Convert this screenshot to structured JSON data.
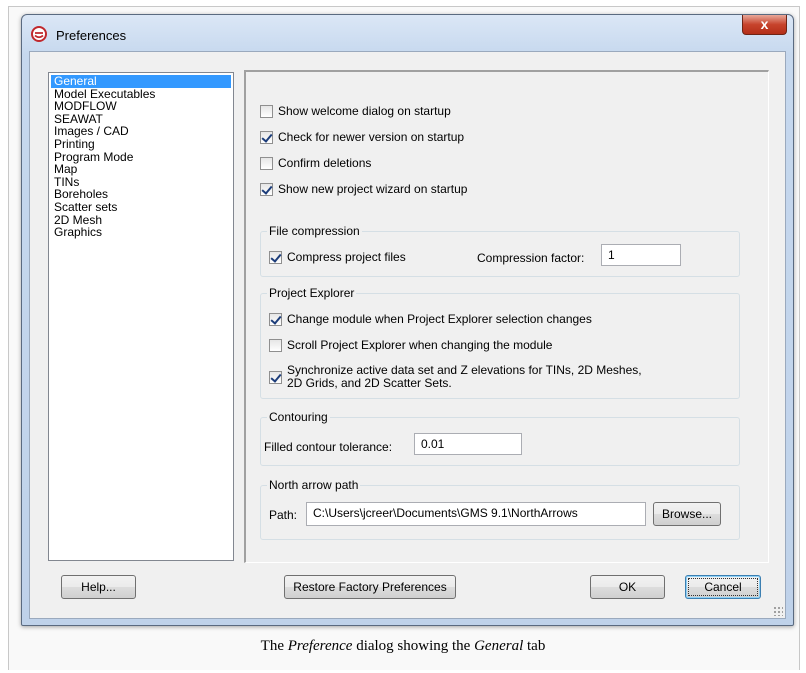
{
  "window": {
    "title": "Preferences",
    "close_label": "x",
    "icon": "app-logo-icon"
  },
  "categories": [
    "General",
    "Model Executables",
    "MODFLOW",
    "SEAWAT",
    "Images / CAD",
    "Printing",
    "Program Mode",
    "Map",
    "TINs",
    "Boreholes",
    "Scatter sets",
    "2D Mesh",
    "Graphics"
  ],
  "selected_category": "General",
  "general": {
    "show_welcome": {
      "label": "Show welcome dialog on startup",
      "checked": false
    },
    "check_newer": {
      "label": "Check for newer version on startup",
      "checked": true
    },
    "confirm_deletions": {
      "label": "Confirm deletions",
      "checked": false
    },
    "show_wizard": {
      "label": "Show new project wizard on startup",
      "checked": true
    }
  },
  "file_compression": {
    "title": "File compression",
    "compress_label": "Compress project files",
    "compress_checked": true,
    "factor_label": "Compression factor:",
    "factor_value": "1"
  },
  "project_explorer": {
    "title": "Project Explorer",
    "change_module": {
      "label": "Change module when Project Explorer selection changes",
      "checked": true
    },
    "scroll_explorer": {
      "label": "Scroll Project Explorer when changing the module",
      "checked": false
    },
    "synchronize_line1": "Synchronize active data set and Z elevations for TINs, 2D Meshes,",
    "synchronize_line2": "2D Grids, and 2D Scatter Sets.",
    "synchronize_checked": true
  },
  "contouring": {
    "title": "Contouring",
    "tolerance_label": "Filled contour tolerance:",
    "tolerance_value": "0.01"
  },
  "north_arrow": {
    "title": "North arrow path",
    "path_label": "Path:",
    "path_value": "C:\\Users\\jcreer\\Documents\\GMS 9.1\\NorthArrows",
    "browse_label": "Browse..."
  },
  "buttons": {
    "help": "Help...",
    "restore": "Restore Factory Preferences",
    "ok": "OK",
    "cancel": "Cancel"
  },
  "caption": {
    "prefix": "The ",
    "em1": "Preference",
    "middle": " dialog showing the ",
    "em2": "General",
    "suffix": " tab"
  },
  "colors": {
    "selection": "#3399ff",
    "close_button": "#c7432c",
    "window_frame": "#c6d8ee"
  }
}
